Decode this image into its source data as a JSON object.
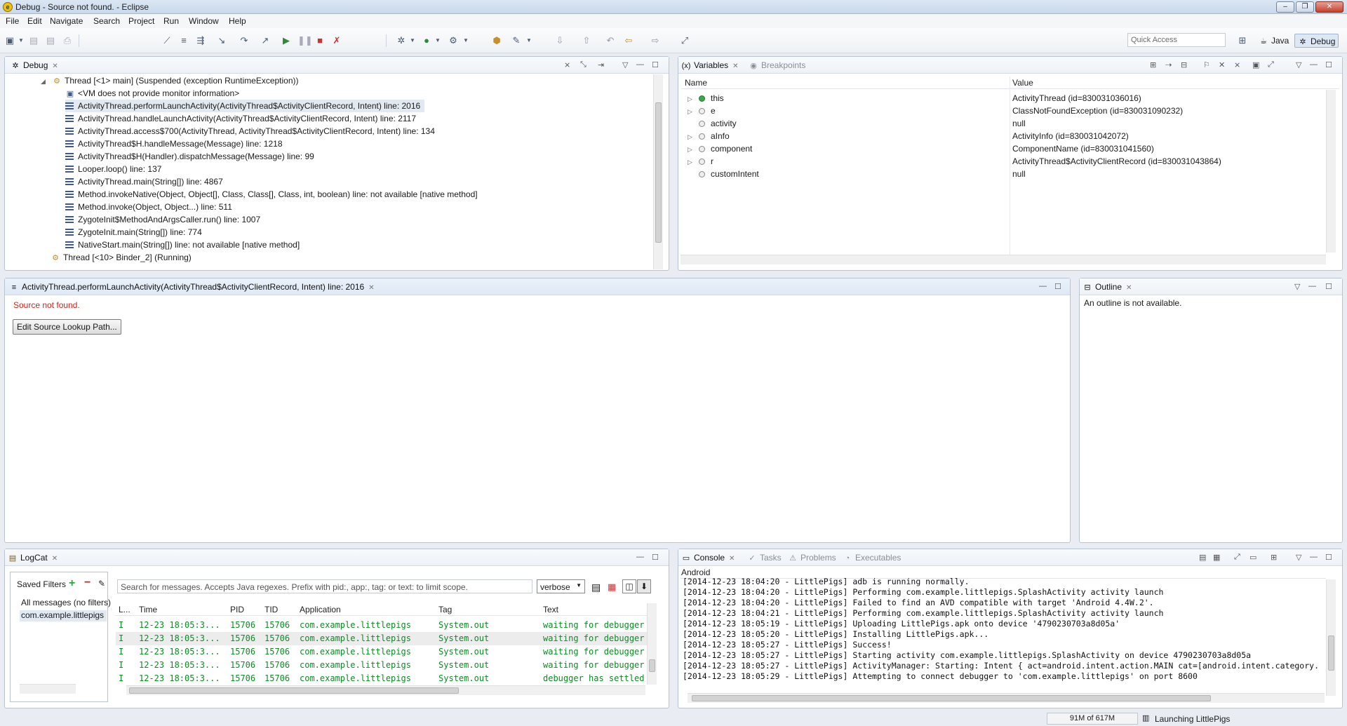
{
  "window": {
    "title": "Debug - Source not found. - Eclipse"
  },
  "menu": [
    "File",
    "Edit",
    "Navigate",
    "Search",
    "Project",
    "Run",
    "Window",
    "Help"
  ],
  "quick_access": "Quick Access",
  "perspectives": {
    "java": "Java",
    "debug": "Debug"
  },
  "debug_view": {
    "tab": "Debug",
    "thread_main": "Thread [<1> main] (Suspended (exception RuntimeException))",
    "monitor_info": "<VM does not provide monitor information>",
    "frames": [
      "ActivityThread.performLaunchActivity(ActivityThread$ActivityClientRecord, Intent) line: 2016",
      "ActivityThread.handleLaunchActivity(ActivityThread$ActivityClientRecord, Intent) line: 2117",
      "ActivityThread.access$700(ActivityThread, ActivityThread$ActivityClientRecord, Intent) line: 134",
      "ActivityThread$H.handleMessage(Message) line: 1218",
      "ActivityThread$H(Handler).dispatchMessage(Message) line: 99",
      "Looper.loop() line: 137",
      "ActivityThread.main(String[]) line: 4867",
      "Method.invokeNative(Object, Object[], Class, Class[], Class, int, boolean) line: not available [native method]",
      "Method.invoke(Object, Object...) line: 511",
      "ZygoteInit$MethodAndArgsCaller.run() line: 1007",
      "ZygoteInit.main(String[]) line: 774",
      "NativeStart.main(String[]) line: not available [native method]"
    ],
    "thread_binder": "Thread [<10> Binder_2] (Running)"
  },
  "variables_view": {
    "tab": "Variables",
    "tab2": "Breakpoints",
    "col_name": "Name",
    "col_value": "Value",
    "rows": [
      {
        "name": "this",
        "value": "ActivityThread  (id=830031036016)"
      },
      {
        "name": "e",
        "value": "ClassNotFoundException  (id=830031090232)"
      },
      {
        "name": "activity",
        "value": "null"
      },
      {
        "name": "aInfo",
        "value": "ActivityInfo  (id=830031042072)"
      },
      {
        "name": "component",
        "value": "ComponentName  (id=830031041560)"
      },
      {
        "name": "r",
        "value": "ActivityThread$ActivityClientRecord  (id=830031043864)"
      },
      {
        "name": "customIntent",
        "value": "null"
      }
    ]
  },
  "editor": {
    "tab": "ActivityThread.performLaunchActivity(ActivityThread$ActivityClientRecord, Intent) line: 2016",
    "message": "Source not found.",
    "button": "Edit Source Lookup Path..."
  },
  "outline": {
    "tab": "Outline",
    "message": "An outline is not available."
  },
  "logcat": {
    "tab": "LogCat",
    "saved_filters": "Saved Filters",
    "filters": [
      "All messages (no filters)",
      "com.example.littlepigs"
    ],
    "search_placeholder": "Search for messages. Accepts Java regexes. Prefix with pid:, app:, tag: or text: to limit scope.",
    "level": "verbose",
    "columns": [
      "L...",
      "Time",
      "PID",
      "TID",
      "Application",
      "Tag",
      "Text"
    ],
    "rows": [
      [
        "I",
        "12-23 18:05:3...",
        "15706",
        "15706",
        "com.example.littlepigs",
        "System.out",
        "waiting for debugger"
      ],
      [
        "I",
        "12-23 18:05:3...",
        "15706",
        "15706",
        "com.example.littlepigs",
        "System.out",
        "waiting for debugger"
      ],
      [
        "I",
        "12-23 18:05:3...",
        "15706",
        "15706",
        "com.example.littlepigs",
        "System.out",
        "waiting for debugger"
      ],
      [
        "I",
        "12-23 18:05:3...",
        "15706",
        "15706",
        "com.example.littlepigs",
        "System.out",
        "waiting for debugger"
      ],
      [
        "I",
        "12-23 18:05:3...",
        "15706",
        "15706",
        "com.example.littlepigs",
        "System.out",
        "debugger has settled"
      ]
    ]
  },
  "console": {
    "tab": "Console",
    "tabs_other": [
      "Tasks",
      "Problems",
      "Executables"
    ],
    "label": "Android",
    "lines": [
      "[2014-12-23 18:04:20 - LittlePigs] adb is running normally.",
      "[2014-12-23 18:04:20 - LittlePigs] Performing com.example.littlepigs.SplashActivity activity launch",
      "[2014-12-23 18:04:20 - LittlePigs] Failed to find an AVD compatible with target 'Android 4.4W.2'.",
      "[2014-12-23 18:04:21 - LittlePigs] Performing com.example.littlepigs.SplashActivity activity launch",
      "[2014-12-23 18:05:19 - LittlePigs] Uploading LittlePigs.apk onto device '4790230703a8d05a'",
      "[2014-12-23 18:05:20 - LittlePigs] Installing LittlePigs.apk...",
      "[2014-12-23 18:05:27 - LittlePigs] Success!",
      "[2014-12-23 18:05:27 - LittlePigs] Starting activity com.example.littlepigs.SplashActivity on device 4790230703a8d05a",
      "[2014-12-23 18:05:27 - LittlePigs] ActivityManager: Starting: Intent { act=android.intent.action.MAIN cat=[android.intent.category.",
      "[2014-12-23 18:05:29 - LittlePigs] Attempting to connect debugger to 'com.example.littlepigs' on port 8600"
    ]
  },
  "status": {
    "memory": "91M of 617M",
    "job": "Launching LittlePigs"
  }
}
